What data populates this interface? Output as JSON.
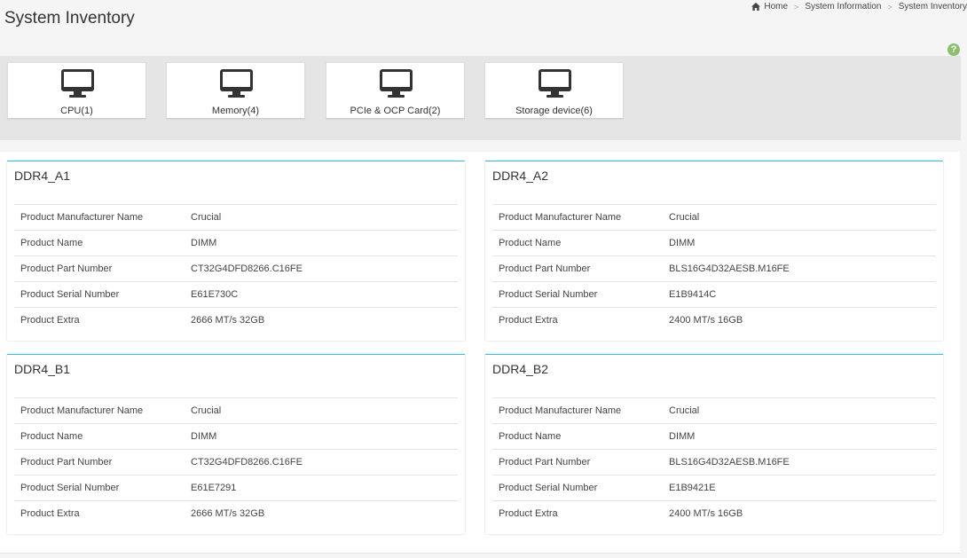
{
  "page": {
    "title": "System Inventory"
  },
  "breadcrumb": [
    "Home",
    "System Information",
    "System Inventory"
  ],
  "help_label": "?",
  "tiles": [
    {
      "label": "CPU(1)",
      "icon": "monitor-icon"
    },
    {
      "label": "Memory(4)",
      "icon": "monitor-icon"
    },
    {
      "label": "PCIe & OCP Card(2)",
      "icon": "monitor-icon"
    },
    {
      "label": "Storage device(6)",
      "icon": "monitor-icon"
    }
  ],
  "colors": {
    "card_accent": "#3dbbe8",
    "help_icon": "#8bbf6e",
    "icon_dark": "#333333"
  },
  "cards": [
    {
      "title": "DDR4_A1",
      "rows": [
        {
          "key": "Product Manufacturer Name",
          "value": "Crucial"
        },
        {
          "key": "Product Name",
          "value": "DIMM"
        },
        {
          "key": "Product Part Number",
          "value": "CT32G4DFD8266.C16FE"
        },
        {
          "key": "Product Serial Number",
          "value": "E61E730C"
        },
        {
          "key": "Product Extra",
          "value": "2666 MT/s 32GB"
        }
      ]
    },
    {
      "title": "DDR4_A2",
      "rows": [
        {
          "key": "Product Manufacturer Name",
          "value": "Crucial"
        },
        {
          "key": "Product Name",
          "value": "DIMM"
        },
        {
          "key": "Product Part Number",
          "value": "BLS16G4D32AESB.M16FE"
        },
        {
          "key": "Product Serial Number",
          "value": "E1B9414C"
        },
        {
          "key": "Product Extra",
          "value": "2400 MT/s 16GB"
        }
      ]
    },
    {
      "title": "DDR4_B1",
      "rows": [
        {
          "key": "Product Manufacturer Name",
          "value": "Crucial"
        },
        {
          "key": "Product Name",
          "value": "DIMM"
        },
        {
          "key": "Product Part Number",
          "value": "CT32G4DFD8266.C16FE"
        },
        {
          "key": "Product Serial Number",
          "value": "E61E7291"
        },
        {
          "key": "Product Extra",
          "value": "2666 MT/s 32GB"
        }
      ]
    },
    {
      "title": "DDR4_B2",
      "rows": [
        {
          "key": "Product Manufacturer Name",
          "value": "Crucial"
        },
        {
          "key": "Product Name",
          "value": "DIMM"
        },
        {
          "key": "Product Part Number",
          "value": "BLS16G4D32AESB.M16FE"
        },
        {
          "key": "Product Serial Number",
          "value": "E1B9421E"
        },
        {
          "key": "Product Extra",
          "value": "2400 MT/s 16GB"
        }
      ]
    }
  ]
}
